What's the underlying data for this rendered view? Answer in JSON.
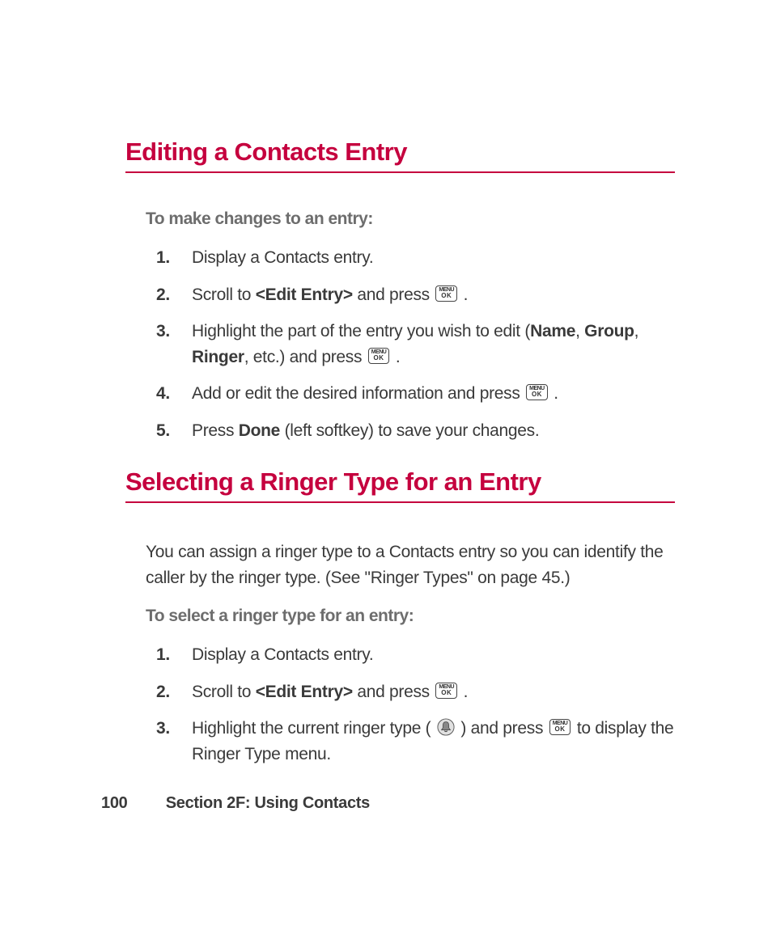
{
  "heading1": "Editing a Contacts Entry",
  "intro1": "To make changes to an entry:",
  "steps1": {
    "s1": "Display a Contacts entry.",
    "s2a": "Scroll to ",
    "s2b": "<Edit Entry>",
    "s2c": " and press ",
    "s2d": " .",
    "s3a": "Highlight the part of the entry you wish to edit (",
    "s3b": "Name",
    "s3c": ", ",
    "s3d": "Group",
    "s3e": ", ",
    "s3f": "Ringer",
    "s3g": ", etc.) and press ",
    "s3h": " .",
    "s4a": "Add or edit the desired information and press ",
    "s4b": " .",
    "s5a": "Press ",
    "s5b": "Done",
    "s5c": " (left softkey) to save your changes."
  },
  "heading2": "Selecting a Ringer Type for an Entry",
  "body2": "You can assign a ringer type to a Contacts entry so you can identify the caller by the ringer type. (See \"Ringer Types\" on page 45.)",
  "intro2": "To select a ringer type for an entry:",
  "steps2": {
    "s1": "Display a Contacts entry.",
    "s2a": "Scroll to ",
    "s2b": "<Edit Entry>",
    "s2c": " and press ",
    "s2d": " .",
    "s3a": "Highlight the current ringer type ( ",
    "s3b": " ) and press ",
    "s3c": " to display the Ringer Type menu."
  },
  "nums": {
    "n1": "1.",
    "n2": "2.",
    "n3": "3.",
    "n4": "4.",
    "n5": "5."
  },
  "footer": {
    "page": "100",
    "section": "Section 2F: Using Contacts"
  },
  "menuok": {
    "top": "MENU",
    "bot": "OK"
  }
}
